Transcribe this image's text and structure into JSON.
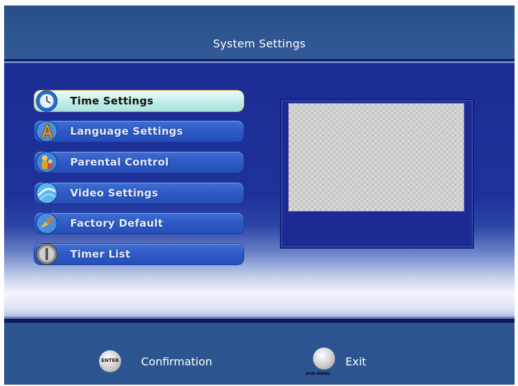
{
  "header": {
    "title": "System Settings"
  },
  "menu": {
    "items": [
      {
        "label": "Time Settings",
        "icon": "clock-icon",
        "selected": true
      },
      {
        "label": "Language Settings",
        "icon": "language-icon",
        "selected": false
      },
      {
        "label": "Parental Control",
        "icon": "parental-icon",
        "selected": false
      },
      {
        "label": "Video Settings",
        "icon": "video-icon",
        "selected": false
      },
      {
        "label": "Factory Default",
        "icon": "factory-reset-icon",
        "selected": false
      },
      {
        "label": "Timer List",
        "icon": "timer-icon",
        "selected": false
      }
    ]
  },
  "footer": {
    "confirm": {
      "button_text": "ENTER",
      "label": "Confirmation"
    },
    "exit": {
      "button_sublabel": "DVB MENU",
      "label": "Exit"
    }
  },
  "colors": {
    "header_bg": "#2f5792",
    "menu_item": "#2d58c4",
    "menu_selected": "#bfeee6",
    "panel_bg": "#1c2b94"
  }
}
